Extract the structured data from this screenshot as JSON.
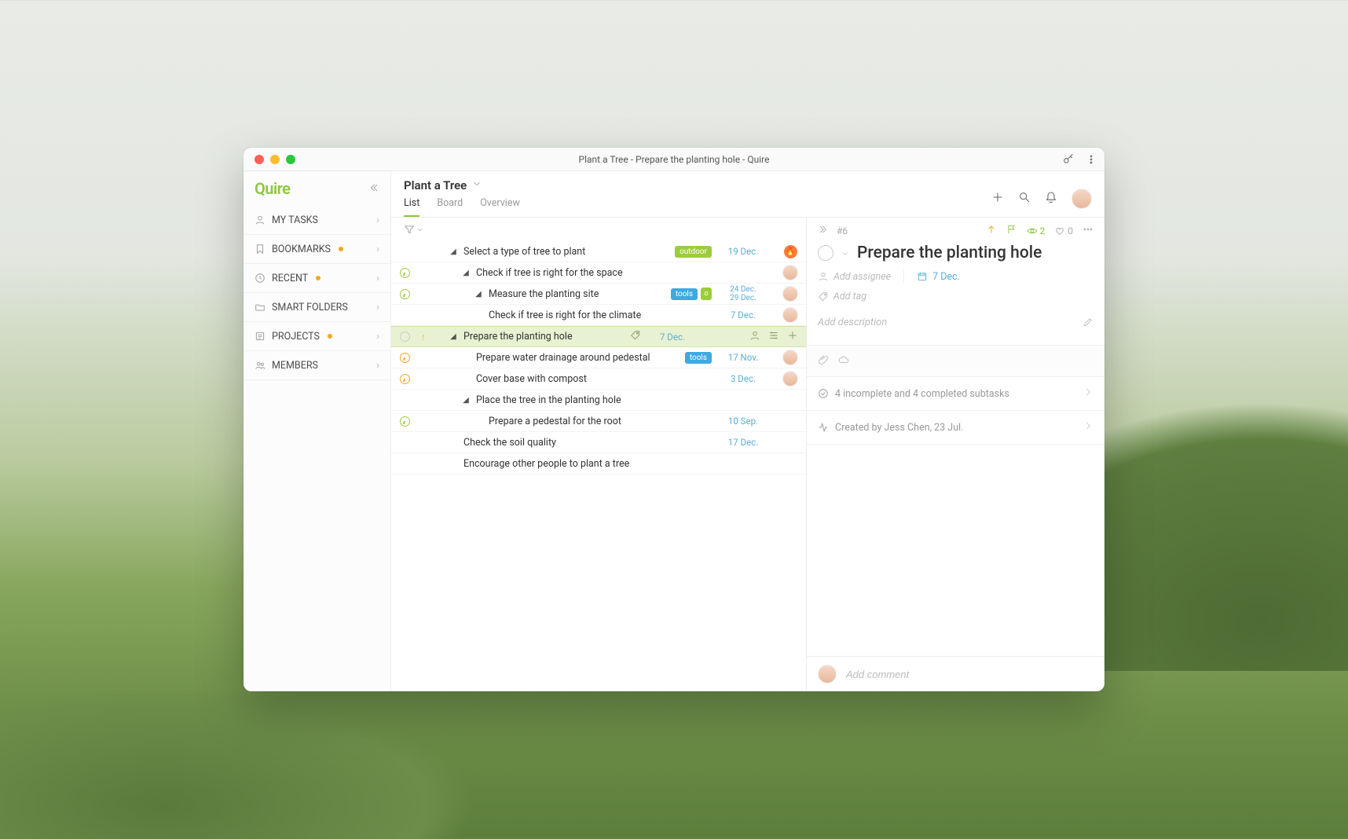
{
  "window": {
    "title": "Plant a Tree - Prepare the planting hole - Quire"
  },
  "sidebar": {
    "logo": "Quire",
    "items": [
      {
        "label": "MY TASKS",
        "icon": "user",
        "dot": false
      },
      {
        "label": "BOOKMARKS",
        "icon": "bookmark",
        "dot": true
      },
      {
        "label": "RECENT",
        "icon": "clock",
        "dot": true
      },
      {
        "label": "SMART FOLDERS",
        "icon": "folder",
        "dot": false
      },
      {
        "label": "PROJECTS",
        "icon": "list",
        "dot": true
      },
      {
        "label": "MEMBERS",
        "icon": "people",
        "dot": false
      }
    ]
  },
  "project": {
    "title": "Plant a Tree",
    "tabs": [
      "List",
      "Board",
      "Overview"
    ],
    "active_tab": "List"
  },
  "tasks": [
    {
      "indent": 1,
      "expand": "down",
      "status": "",
      "title": "Select a type of tree to plant",
      "tags": [
        {
          "t": "outdoor",
          "c": "green"
        }
      ],
      "date": "19 Dec.",
      "avatar": "fire"
    },
    {
      "indent": 2,
      "expand": "down",
      "status": "timer-g",
      "title": "Check if tree is right for the space",
      "tags": [],
      "date": "",
      "avatar": "a"
    },
    {
      "indent": 3,
      "expand": "down",
      "status": "timer-g",
      "title": "Measure the planting site",
      "tags": [
        {
          "t": "tools",
          "c": "blue"
        },
        {
          "t": "o",
          "c": "sq"
        }
      ],
      "date": "24 Dec. - 29 Dec.",
      "avatar": "a",
      "range": true
    },
    {
      "indent": 3,
      "expand": "",
      "status": "",
      "title": "Check if tree is right for the climate",
      "tags": [],
      "date": "7 Dec.",
      "avatar": "a"
    },
    {
      "indent": 1,
      "expand": "down",
      "status": "open",
      "title": "Prepare the planting hole",
      "tags": [],
      "date": "7 Dec.",
      "avatar": "",
      "selected": true,
      "up": true,
      "tagIcon": true
    },
    {
      "indent": 2,
      "expand": "",
      "status": "timer-o",
      "title": "Prepare water drainage around pedestal",
      "tags": [
        {
          "t": "tools",
          "c": "blue"
        }
      ],
      "date": "17 Nov.",
      "avatar": "a"
    },
    {
      "indent": 2,
      "expand": "",
      "status": "timer-o",
      "title": "Cover base with compost",
      "tags": [],
      "date": "3 Dec.",
      "avatar": "a"
    },
    {
      "indent": 2,
      "expand": "down",
      "status": "",
      "title": "Place the tree in the planting hole",
      "tags": [],
      "date": "",
      "avatar": ""
    },
    {
      "indent": 3,
      "expand": "",
      "status": "timer-g",
      "title": "Prepare a pedestal for the root",
      "tags": [],
      "date": "10 Sep.",
      "avatar": ""
    },
    {
      "indent": 1,
      "expand": "",
      "status": "",
      "title": "Check the soil quality",
      "tags": [],
      "date": "17 Dec.",
      "avatar": ""
    },
    {
      "indent": 1,
      "expand": "",
      "status": "",
      "title": "Encourage other people to plant a tree",
      "tags": [],
      "date": "",
      "avatar": ""
    }
  ],
  "detail": {
    "id": "#6",
    "followers": "2",
    "likes": "0",
    "title": "Prepare the planting hole",
    "assignee_placeholder": "Add assignee",
    "due": "7 Dec.",
    "tag_placeholder": "Add tag",
    "desc_placeholder": "Add description",
    "subtasks_summary": "4 incomplete and 4 completed subtasks",
    "created_by": "Created by Jess Chen, 23 Jul.",
    "comment_placeholder": "Add comment"
  }
}
